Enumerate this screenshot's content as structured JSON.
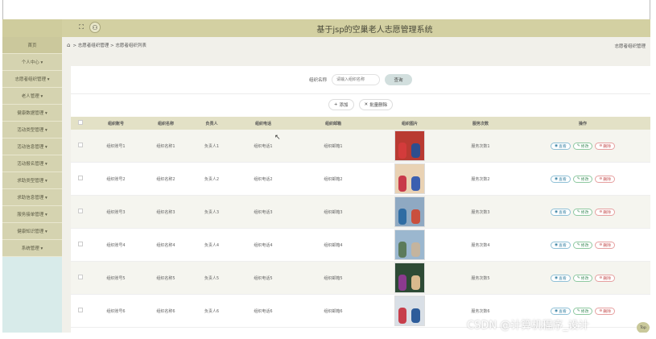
{
  "header": {
    "title": "基于jsp的空巢老人志愿管理系统",
    "fullscreen_icon": "expand-icon",
    "user_icon": "user-icon"
  },
  "sidebar": {
    "items": [
      {
        "label": "首页"
      },
      {
        "label": "个人中心 ▾"
      },
      {
        "label": "志愿者组织管理 ▾"
      },
      {
        "label": "老人管理 ▾"
      },
      {
        "label": "健康数据管理 ▾"
      },
      {
        "label": "活动类型管理 ▾"
      },
      {
        "label": "活动信息管理 ▾"
      },
      {
        "label": "活动报名管理 ▾"
      },
      {
        "label": "求助类型管理 ▾"
      },
      {
        "label": "求助信息管理 ▾"
      },
      {
        "label": "服务接单管理 ▾"
      },
      {
        "label": "健康知识管理 ▾"
      },
      {
        "label": "系统管理 ▾"
      }
    ]
  },
  "breadcrumb": {
    "home_icon": "home-icon",
    "path": "> 志愿者组织管理 > 志愿者组织列表",
    "right": "志愿者组织管理"
  },
  "search": {
    "label": "组织名称",
    "placeholder": "请输入组织名称",
    "button": "查询"
  },
  "actions": {
    "add": "添加",
    "batch_delete": "批量删除"
  },
  "table": {
    "headers": [
      "组织账号",
      "组织名称",
      "负责人",
      "组织电话",
      "组织邮箱",
      "组织图片",
      "服务次数",
      "操作"
    ],
    "rows": [
      [
        "组织账号1",
        "组织名称1",
        "负责人1",
        "组织电话1",
        "组织邮箱1",
        "服务次数1"
      ],
      [
        "组织账号2",
        "组织名称2",
        "负责人2",
        "组织电话2",
        "组织邮箱2",
        "服务次数2"
      ],
      [
        "组织账号3",
        "组织名称3",
        "负责人3",
        "组织电话3",
        "组织邮箱3",
        "服务次数3"
      ],
      [
        "组织账号4",
        "组织名称4",
        "负责人4",
        "组织电话4",
        "组织邮箱4",
        "服务次数4"
      ],
      [
        "组织账号5",
        "组织名称5",
        "负责人5",
        "组织电话5",
        "组织邮箱5",
        "服务次数5"
      ],
      [
        "组织账号6",
        "组织名称6",
        "负责人6",
        "组织电话6",
        "组织邮箱6",
        "服务次数6"
      ]
    ],
    "row_actions": {
      "view": "查看",
      "edit": "修改",
      "delete": "删除"
    }
  },
  "thumb_colors": [
    [
      "#b93a32",
      "#d33b3b",
      "#2e4e8f"
    ],
    [
      "#e9d2b4",
      "#c83a4a",
      "#3b5fb0"
    ],
    [
      "#8fa9c2",
      "#2f6ca3",
      "#c94f3d"
    ],
    [
      "#9bb7cf",
      "#5c7b5b",
      "#c4b49e"
    ],
    [
      "#2d4a35",
      "#8b3a8f",
      "#d9b98e"
    ],
    [
      "#d9dfe6",
      "#c73e4b",
      "#2d5c9a"
    ]
  ],
  "watermark": "CSDN @计算机程序_设计",
  "top_button": "Top"
}
